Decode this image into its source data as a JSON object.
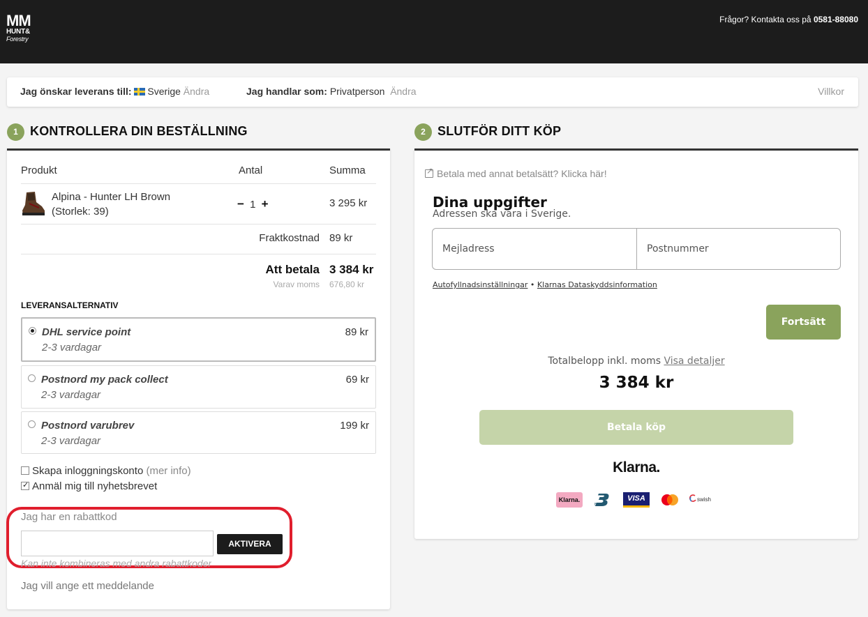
{
  "header": {
    "logo_top": "MM",
    "logo_bottom": "HUNT&",
    "logo_bottom2": "Forestry",
    "contact_prefix": "Frågor? Kontakta oss på",
    "contact_phone": "0581-88080"
  },
  "infobar": {
    "delivery_label": "Jag önskar leverans till:",
    "delivery_country": "Sverige",
    "delivery_change": "Ändra",
    "buyer_label": "Jag handlar som:",
    "buyer_type": "Privatperson",
    "buyer_change": "Ändra",
    "terms": "Villkor"
  },
  "step1": {
    "num": "1",
    "title": "KONTROLLERA DIN BESTÄLLNING",
    "col_product": "Produkt",
    "col_qty": "Antal",
    "col_sum": "Summa",
    "product_name": "Alpina - Hunter LH Brown",
    "product_variant": "(Storlek: 39)",
    "qty_minus": "−",
    "qty": "1",
    "qty_plus": "+",
    "product_sum": "3 295 kr",
    "shipping_label": "Fraktkostnad",
    "shipping_value": "89 kr",
    "total_label": "Att betala",
    "total_value": "3 384 kr",
    "vat_label": "Varav moms",
    "vat_value": "676,80 kr",
    "delivery_heading": "LEVERANSALTERNATIV",
    "delivery_options": [
      {
        "name": "DHL service point",
        "days": "2-3 vardagar",
        "price": "89 kr",
        "selected": true
      },
      {
        "name": "Postnord my pack collect",
        "days": "2-3 vardagar",
        "price": "69 kr",
        "selected": false
      },
      {
        "name": "Postnord varubrev",
        "days": "2-3 vardagar",
        "price": "199 kr",
        "selected": false
      }
    ],
    "create_account": "Skapa inloggningskonto",
    "create_account_more_pre": "(",
    "create_account_more": "mer info",
    "create_account_more_post": ")",
    "newsletter": "Anmäl mig till nyhetsbrevet",
    "promo_label": "Jag har en rabattkod",
    "promo_button": "AKTIVERA",
    "promo_note": "Kan inte kombineras med andra rabattkoder",
    "message": "Jag vill ange ett meddelande"
  },
  "step2": {
    "num": "2",
    "title": "SLUTFÖR DITT KÖP",
    "alt_payment": "Betala med annat betalsätt? Klicka här!",
    "heading": "Dina uppgifter",
    "subheading": "Adressen ska vara i Sverige.",
    "email_placeholder": "Mejladress",
    "postal_placeholder": "Postnummer",
    "link_autofill": "Autofyllnadsinställningar",
    "link_sep": " • ",
    "link_privacy": "Klarnas Dataskyddsinformation",
    "continue": "Fortsätt",
    "total_label": "Totalbelopp inkl. moms",
    "total_details": "Visa detaljer",
    "total_amount": "3 384 kr",
    "pay": "Betala köp",
    "klarna": "Klarna.",
    "pm_klarna": "Klarna.",
    "pm_bankid": "BankID",
    "pm_visa": "VISA",
    "pm_swish": "swish"
  },
  "colors": {
    "accent_green": "#8aa35c",
    "pay_disabled": "#c5d4a9",
    "highlight_red": "#e01e2d",
    "header_bg": "#1c1c1c"
  }
}
